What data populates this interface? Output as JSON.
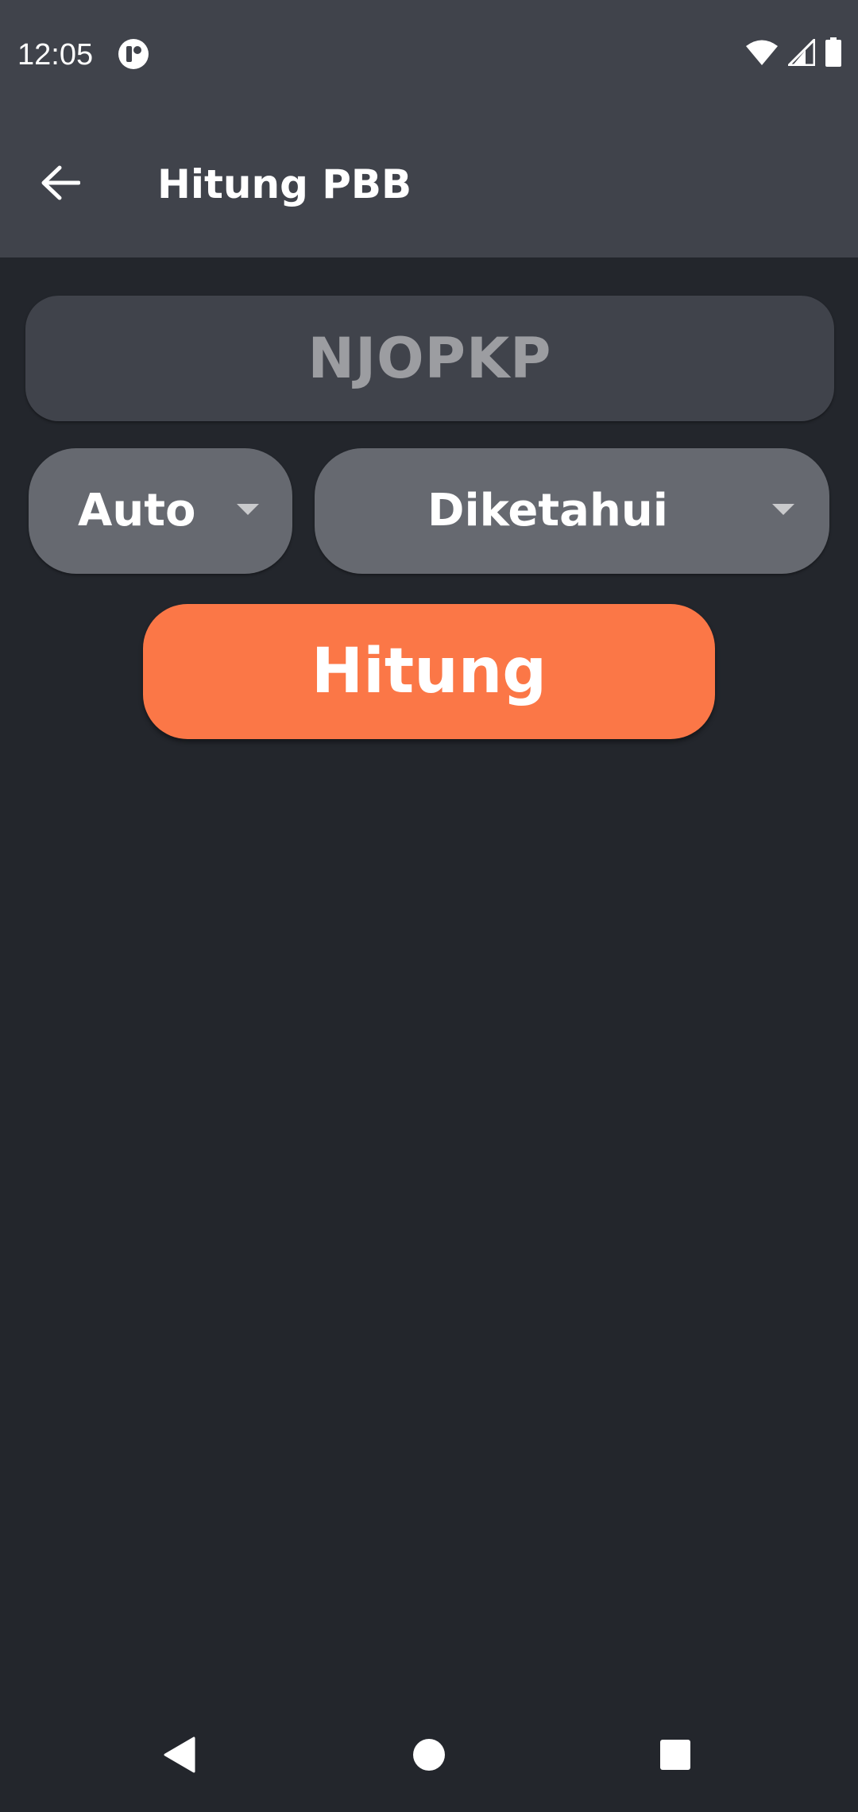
{
  "status_bar": {
    "time": "12:05",
    "notification_icon": "app-notification-icon",
    "wifi_icon": "wifi-icon",
    "signal_icon": "signal-icon",
    "battery_icon": "battery-icon"
  },
  "app_bar": {
    "back_icon": "arrow-left-icon",
    "title": "Hitung PBB"
  },
  "form": {
    "njopkp_placeholder": "NJOPKP",
    "njopkp_value": "",
    "mode_dropdown": {
      "selected": "Auto"
    },
    "status_dropdown": {
      "selected": "Diketahui"
    },
    "submit_label": "Hitung"
  },
  "nav_bar": {
    "back_icon": "nav-back-icon",
    "home_icon": "nav-home-icon",
    "recents_icon": "nav-recents-icon"
  },
  "colors": {
    "background": "#23262c",
    "bar": "#40434b",
    "dropdown": "#666970",
    "accent": "#fb7747",
    "placeholder": "#9c9da1"
  }
}
